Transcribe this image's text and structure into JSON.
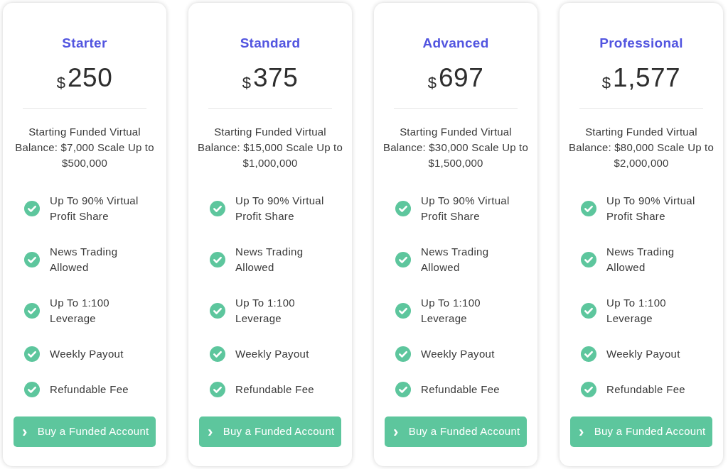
{
  "plans": [
    {
      "name": "Starter",
      "currency": "$",
      "price": "250",
      "description": "Starting Funded Virtual Balance: $7,000 Scale Up to $500,000",
      "features": [
        {
          "text": "Up To 90% Virtual Profit Share",
          "included": true
        },
        {
          "text": "News Trading Allowed",
          "included": true
        },
        {
          "text": "Up To 1:100 Leverage",
          "included": true
        },
        {
          "text": "Weekly Payout",
          "included": true
        },
        {
          "text": "Refundable Fee",
          "included": true
        }
      ],
      "button": {
        "arrow": "›",
        "label": "Buy a Funded Account"
      }
    },
    {
      "name": "Standard",
      "currency": "$",
      "price": "375",
      "description": "Starting Funded Virtual Balance: $15,000 Scale Up to $1,000,000",
      "features": [
        {
          "text": "Up To 90% Virtual Profit Share",
          "included": true
        },
        {
          "text": "News Trading Allowed",
          "included": true
        },
        {
          "text": "Up To 1:100 Leverage",
          "included": true
        },
        {
          "text": "Weekly Payout",
          "included": true
        },
        {
          "text": "Refundable Fee",
          "included": true
        }
      ],
      "button": {
        "arrow": "›",
        "label": "Buy a Funded Account"
      }
    },
    {
      "name": "Advanced",
      "currency": "$",
      "price": "697",
      "description": "Starting Funded Virtual Balance: $30,000 Scale Up to $1,500,000",
      "features": [
        {
          "text": "Up To 90% Virtual Profit Share",
          "included": true
        },
        {
          "text": "News Trading Allowed",
          "included": true
        },
        {
          "text": "Up To 1:100 Leverage",
          "included": true
        },
        {
          "text": "Weekly Payout",
          "included": true
        },
        {
          "text": "Refundable Fee",
          "included": true
        }
      ],
      "button": {
        "arrow": "›",
        "label": "Buy a Funded Account"
      }
    },
    {
      "name": "Professional",
      "currency": "$",
      "price": "1,577",
      "description": "Starting Funded Virtual Balance: $80,000 Scale Up to $2,000,000",
      "features": [
        {
          "text": "Up To 90% Virtual Profit Share",
          "included": true
        },
        {
          "text": "News Trading Allowed",
          "included": true
        },
        {
          "text": "Up To 1:100 Leverage",
          "included": true
        },
        {
          "text": "Weekly Payout",
          "included": true
        },
        {
          "text": "Refundable Fee",
          "included": true
        }
      ],
      "button": {
        "arrow": "›",
        "label": "Buy a Funded Account"
      }
    }
  ]
}
